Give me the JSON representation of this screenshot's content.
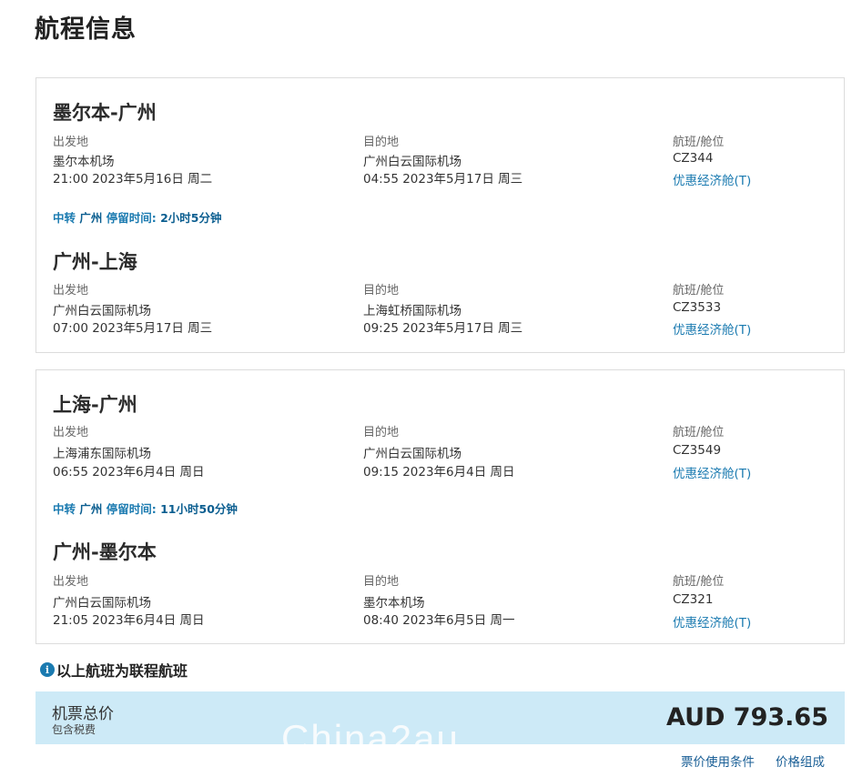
{
  "page_title": "航程信息",
  "labels": {
    "origin": "出发地",
    "destination": "目的地",
    "flight_cabin": "航班/舱位"
  },
  "trips": [
    {
      "segments": [
        {
          "route": "墨尔本-广州",
          "origin_airport": "墨尔本机场",
          "origin_time": "21:00 2023年5月16日 周二",
          "dest_airport": "广州白云国际机场",
          "dest_time": "04:55 2023年5月17日 周三",
          "flight": "CZ344",
          "cabin": "优惠经济舱(T)"
        },
        {
          "route": "广州-上海",
          "origin_airport": "广州白云国际机场",
          "origin_time": "07:00 2023年5月17日 周三",
          "dest_airport": "上海虹桥国际机场",
          "dest_time": "09:25 2023年5月17日 周三",
          "flight": "CZ3533",
          "cabin": "优惠经济舱(T)"
        }
      ],
      "transfer": {
        "prefix": "中转",
        "city": "广州",
        "stay_label": "停留时间:",
        "duration": "2小时5分钟"
      }
    },
    {
      "segments": [
        {
          "route": "上海-广州",
          "origin_airport": "上海浦东国际机场",
          "origin_time": "06:55 2023年6月4日 周日",
          "dest_airport": "广州白云国际机场",
          "dest_time": "09:15 2023年6月4日 周日",
          "flight": "CZ3549",
          "cabin": "优惠经济舱(T)"
        },
        {
          "route": "广州-墨尔本",
          "origin_airport": "广州白云国际机场",
          "origin_time": "21:05 2023年6月4日 周日",
          "dest_airport": "墨尔本机场",
          "dest_time": "08:40 2023年6月5日 周一",
          "flight": "CZ321",
          "cabin": "优惠经济舱(T)"
        }
      ],
      "transfer": {
        "prefix": "中转",
        "city": "广州",
        "stay_label": "停留时间:",
        "duration": "11小时50分钟"
      }
    }
  ],
  "connection_note": "以上航班为联程航班",
  "total": {
    "label": "机票总价",
    "sub_label": "包含税费",
    "amount": "AUD 793.65",
    "watermark": "China2au"
  },
  "links": {
    "fare_rules": "票价使用条件",
    "price_breakdown": "价格组成"
  },
  "colors": {
    "accent": "#1a7ab0",
    "total_bg": "#cdeaf7",
    "border": "#dcdcdc"
  },
  "icons": {
    "info": "info-icon"
  }
}
